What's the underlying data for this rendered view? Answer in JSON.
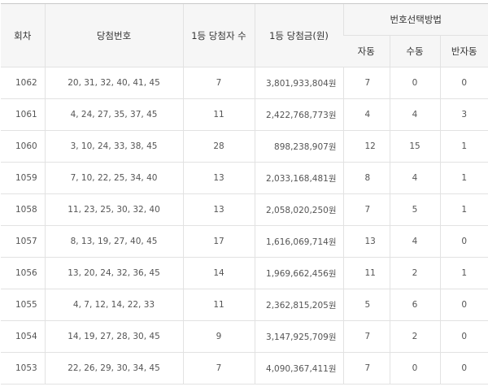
{
  "headers": {
    "round": "회차",
    "numbers": "당첨번호",
    "winners": "1등 당첨자 수",
    "prize": "1등 당첨금(원)",
    "method": "번호선택방법",
    "auto": "자동",
    "manual": "수동",
    "semi": "반자동"
  },
  "rows": [
    {
      "round": "1062",
      "numbers": "20, 31, 32, 40, 41, 45",
      "winners": "7",
      "prize": "3,801,933,804원",
      "auto": "7",
      "manual": "0",
      "semi": "0"
    },
    {
      "round": "1061",
      "numbers": "4, 24, 27, 35, 37, 45",
      "winners": "11",
      "prize": "2,422,768,773원",
      "auto": "4",
      "manual": "4",
      "semi": "3"
    },
    {
      "round": "1060",
      "numbers": "3, 10, 24, 33, 38, 45",
      "winners": "28",
      "prize": "898,238,907원",
      "auto": "12",
      "manual": "15",
      "semi": "1"
    },
    {
      "round": "1059",
      "numbers": "7, 10, 22, 25, 34, 40",
      "winners": "13",
      "prize": "2,033,168,481원",
      "auto": "8",
      "manual": "4",
      "semi": "1"
    },
    {
      "round": "1058",
      "numbers": "11, 23, 25, 30, 32, 40",
      "winners": "13",
      "prize": "2,058,020,250원",
      "auto": "7",
      "manual": "5",
      "semi": "1"
    },
    {
      "round": "1057",
      "numbers": "8, 13, 19, 27, 40, 45",
      "winners": "17",
      "prize": "1,616,069,714원",
      "auto": "13",
      "manual": "4",
      "semi": "0"
    },
    {
      "round": "1056",
      "numbers": "13, 20, 24, 32, 36, 45",
      "winners": "14",
      "prize": "1,969,662,456원",
      "auto": "11",
      "manual": "2",
      "semi": "1"
    },
    {
      "round": "1055",
      "numbers": "4, 7, 12, 14, 22, 33",
      "winners": "11",
      "prize": "2,362,815,205원",
      "auto": "5",
      "manual": "6",
      "semi": "0"
    },
    {
      "round": "1054",
      "numbers": "14, 19, 27, 28, 30, 45",
      "winners": "9",
      "prize": "3,147,925,709원",
      "auto": "7",
      "manual": "2",
      "semi": "0"
    },
    {
      "round": "1053",
      "numbers": "22, 26, 29, 30, 34, 45",
      "winners": "7",
      "prize": "4,090,367,411원",
      "auto": "7",
      "manual": "0",
      "semi": "0"
    }
  ]
}
